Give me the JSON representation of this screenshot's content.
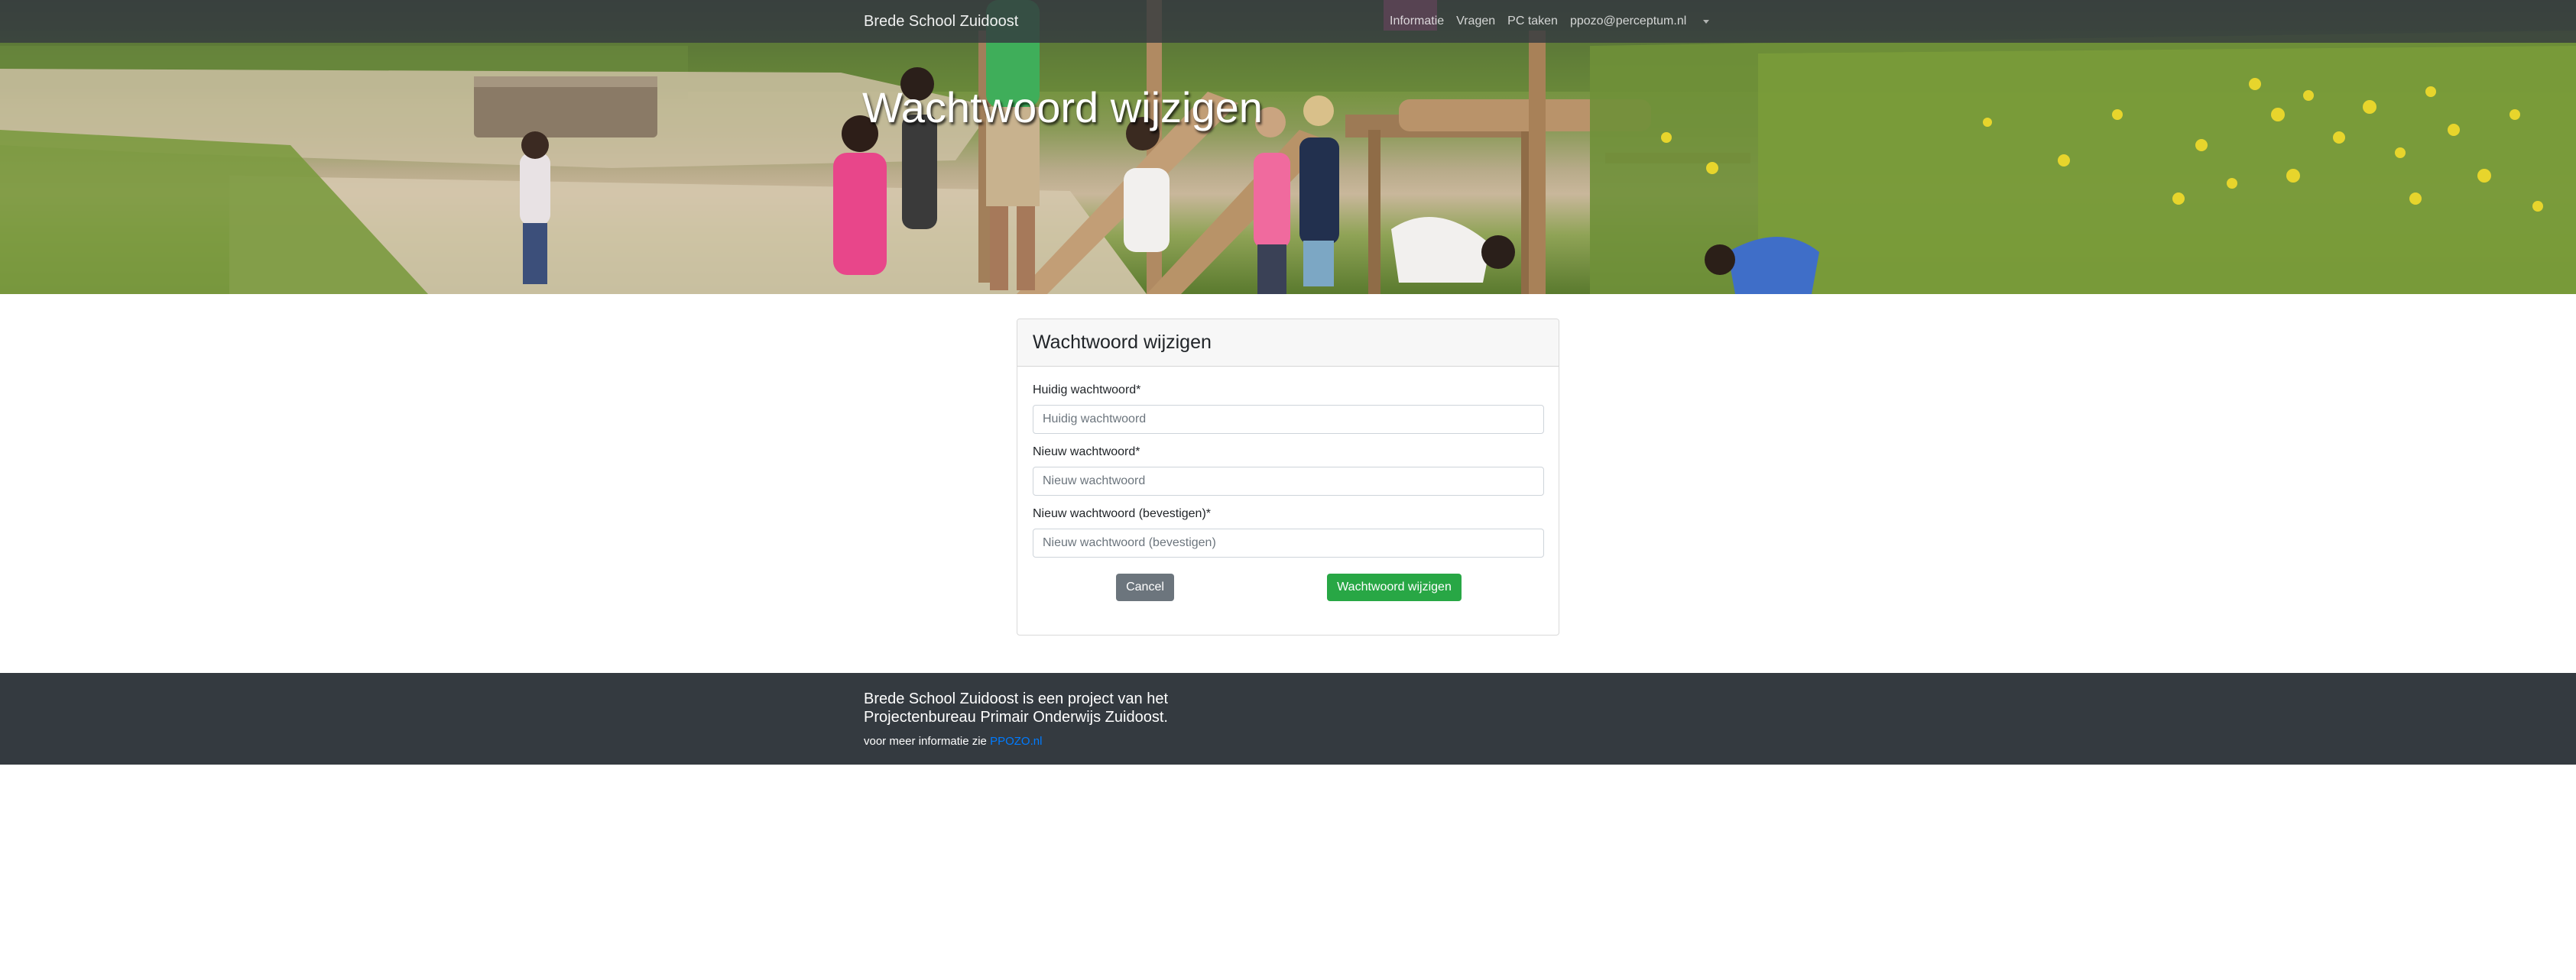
{
  "navbar": {
    "brand": "Brede School Zuidoost",
    "links": [
      "Informatie",
      "Vragen",
      "PC taken",
      "ppozo@perceptum.nl"
    ],
    "dropdown_icon": "caret-down-icon"
  },
  "hero": {
    "title": "Wachtwoord wijzigen"
  },
  "form": {
    "title": "Wachtwoord wijzigen",
    "fields": [
      {
        "label": "Huidig wachtwoord*",
        "placeholder": "Huidig wachtwoord",
        "value": ""
      },
      {
        "label": "Nieuw wachtwoord*",
        "placeholder": "Nieuw wachtwoord",
        "value": ""
      },
      {
        "label": "Nieuw wachtwoord (bevestigen)*",
        "placeholder": "Nieuw wachtwoord (bevestigen)",
        "value": ""
      }
    ],
    "cancel_label": "Cancel",
    "submit_label": "Wachtwoord wijzigen"
  },
  "footer": {
    "text": "Brede School Zuidoost is een project van het Projectenbureau Primair Onderwijs Zuidoost.",
    "info_prefix": "voor meer informatie zie",
    "link_label": "PPOZO.nl"
  },
  "colors": {
    "navbar": "#343a40",
    "footer": "#343a40",
    "cancel_button": "#6c757d",
    "submit_button": "#28a745",
    "link": "#007bff"
  }
}
